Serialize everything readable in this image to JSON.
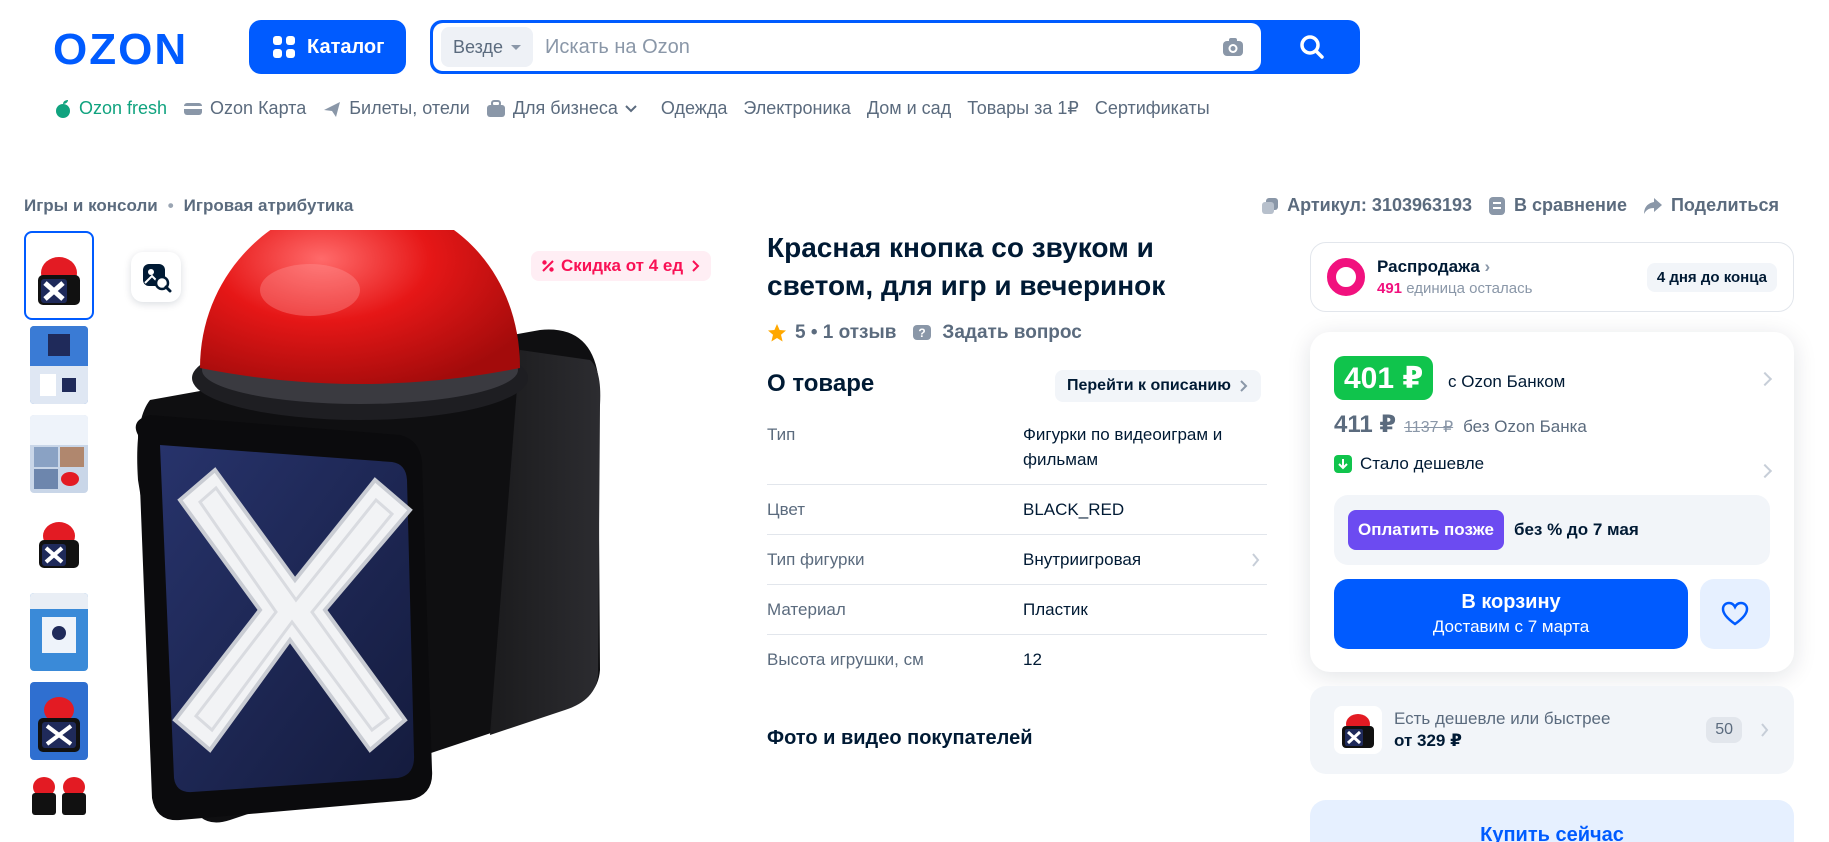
{
  "header": {
    "logo_text": "OZON",
    "catalog_label": "Каталог",
    "search_scope": "Везде",
    "search_placeholder": "Искать на Ozon",
    "brand_color": "#005bff"
  },
  "topnav": [
    {
      "label": "Ozon fresh",
      "icon": "leaf-icon"
    },
    {
      "label": "Ozon Карта",
      "icon": "card-icon"
    },
    {
      "label": "Билеты, отели",
      "icon": "plane-icon"
    },
    {
      "label": "Для бизнеса",
      "icon": "briefcase-icon"
    },
    {
      "label": "Одежда"
    },
    {
      "label": "Электроника"
    },
    {
      "label": "Дом и сад"
    },
    {
      "label": "Товары за 1₽"
    },
    {
      "label": "Сертификаты"
    }
  ],
  "breadcrumb": [
    "Игры и консоли",
    "Игровая атрибутика"
  ],
  "meta": {
    "article": "Артикул: 3103963193",
    "compare": "В сравнение",
    "share": "Поделиться"
  },
  "gallery": {
    "discount_badge": "Скидка от 4 ед",
    "thumbnail_count": 7
  },
  "product": {
    "title": "Красная кнопка со звуком и светом, для игр и вечеринок",
    "rating": "5 • 1 отзыв",
    "ask_question": "Задать вопрос",
    "about_title": "О товаре",
    "to_description": "Перейти к описанию",
    "specs": [
      {
        "key": "Тип",
        "value": "Фигурки по видеоиграм и фильмам"
      },
      {
        "key": "Цвет",
        "value": "BLACK_RED"
      },
      {
        "key": "Тип фигурки",
        "value": "Внутриигровая"
      },
      {
        "key": "Материал",
        "value": "Пластик"
      },
      {
        "key": "Высота игрушки, см",
        "value": "12"
      }
    ],
    "photos_title": "Фото и видео покупателей"
  },
  "sale": {
    "title": "Распродажа",
    "remaining_count": "491",
    "remaining_text": "единица осталась",
    "days_left": "4 дня до конца"
  },
  "price": {
    "bank_price": "401 ₽",
    "bank_label": "с Ozon Банком",
    "regular_price": "411 ₽",
    "old_price": "1137 ₽",
    "regular_label": "без Ozon Банка",
    "cheaper": "Стало дешевле",
    "pay_later_btn": "Оплатить позже",
    "pay_later_text": "без % до 7 мая",
    "cart_label": "В корзину",
    "cart_sub": "Доставим с 7 марта"
  },
  "offers": {
    "line1": "Есть дешевле или быстрее",
    "line2": "от 329 ₽",
    "count": "50"
  },
  "buy_now": "Купить сейчас"
}
